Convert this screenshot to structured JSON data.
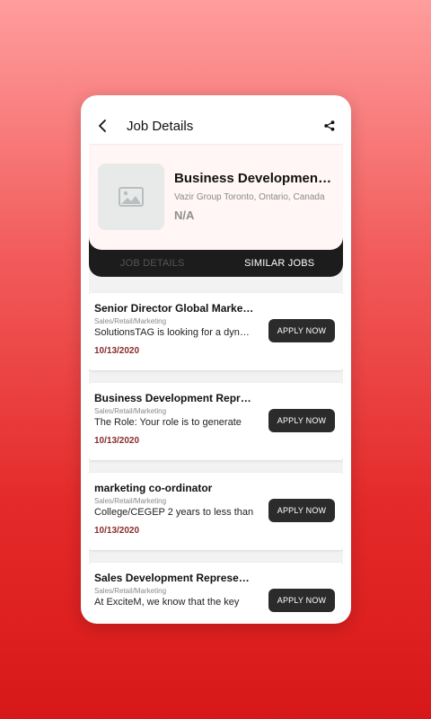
{
  "appbar": {
    "title": "Job Details",
    "back_icon": "chevron-left-icon",
    "share_icon": "share-icon"
  },
  "job": {
    "title": "Business Development…",
    "company_location": "Vazir Group Toronto, Ontario, Canada",
    "salary": "N/A",
    "logo_icon": "image-placeholder-icon"
  },
  "tabs": [
    {
      "label": "JOB DETAILS",
      "active": false
    },
    {
      "label": "SIMILAR JOBS",
      "active": true
    }
  ],
  "similar_jobs": [
    {
      "title": "Senior Director Global Marketing",
      "category": "Sales/Retail/Marketing",
      "description": "SolutionsTAG is looking for a dynamic",
      "date": "10/13/2020",
      "button": "APPLY NOW"
    },
    {
      "title": "Business Development Representative",
      "category": "Sales/Retail/Marketing",
      "description": "The Role:  Your role is to generate",
      "date": "10/13/2020",
      "button": "APPLY NOW"
    },
    {
      "title": "marketing co-ordinator",
      "category": "Sales/Retail/Marketing",
      "description": "College/CEGEP 2 years to less than",
      "date": "10/13/2020",
      "button": "APPLY NOW"
    },
    {
      "title": "Sales Development Representative",
      "category": "Sales/Retail/Marketing",
      "description": "At ExciteM, we know that the key",
      "date": "",
      "button": "APPLY NOW"
    }
  ],
  "colors": {
    "accent_dark": "#1c1c1c",
    "date_color": "#8b2a2a",
    "background_red": "#e42a2a"
  }
}
